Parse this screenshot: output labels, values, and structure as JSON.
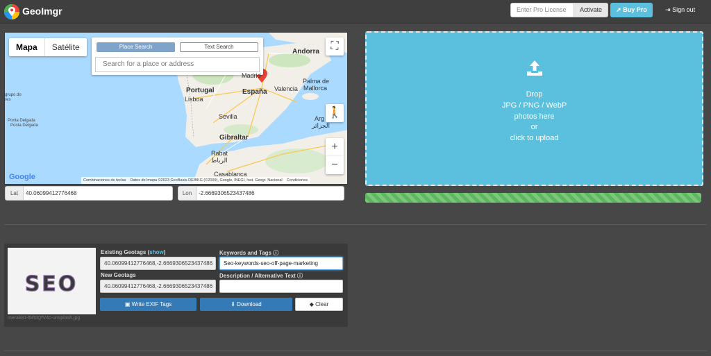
{
  "header": {
    "app_title": "GeoImgr",
    "license_placeholder": "Enter Pro License",
    "activate_label": "Activate",
    "buy_pro_label": "Buy Pro",
    "sign_out_label": "Sign out"
  },
  "map": {
    "tabs": [
      "Mapa",
      "Satélite"
    ],
    "place_search_label": "Place Search",
    "text_search_label": "Text Search",
    "search_placeholder": "Search for a place or address",
    "labels": {
      "andorra": "Andorra",
      "madrid": "Madrid",
      "portugal": "Portugal",
      "espana": "España",
      "valencia": "Valencia",
      "palma": "Palma de",
      "mallorca": "Mallorca",
      "lisboa": "Lisboa",
      "sevilla": "Sevilla",
      "gibraltar": "Gibraltar",
      "rabat": "Rabat",
      "rabat_ar": "الرباط",
      "casablanca": "Casablanca",
      "alger_ar": "الجزائر",
      "alger": "Arg",
      "grupo": "grupo do",
      "acores": "res",
      "ponta": "Ponta Delgada",
      "ponta2": "Ponta Delgada"
    },
    "google_label": "Google",
    "attribution_1": "Combinaciones de teclas",
    "attribution_2": "Datos del mapa ©2023 GeoBasis-DE/BKG (©2009), Google, INEGI, Inst. Geogr. Nacional",
    "attribution_3": "Condiciones"
  },
  "coords": {
    "lat_label": "Lat",
    "lat_value": "40.06099412776468",
    "lon_label": "Lon",
    "lon_value": "-2.6669306523437486"
  },
  "drop": {
    "line1": "Drop",
    "line2": "JPG / PNG / WebP",
    "line3": "photos here",
    "line4": "or",
    "line5": "click to upload"
  },
  "progress": {
    "percent": 100
  },
  "image_card": {
    "filename": "merakist-l5if0iQfV4c-unsplash.jpg",
    "thumb_text": "SEO",
    "existing_geotags_label": "Existing Geotags",
    "show_link": "show",
    "existing_geotags_value": "40.06099412776468,-2.6669306523437486",
    "new_geotags_label": "New Geotags",
    "new_geotags_value": "40.06099412776468,-2.6669306523437486",
    "keywords_label": "Keywords and Tags",
    "keywords_value": "Seo-keywords-seo-off-page-marketing",
    "description_label": "Description / Alternative Text",
    "description_value": "",
    "write_exif_label": "Write EXIF Tags",
    "download_label": "Download",
    "clear_label": "Clear"
  },
  "colors": {
    "accent": "#5bc0de",
    "primary": "#337ab7",
    "success": "#5cb85c",
    "background": "#474747"
  }
}
